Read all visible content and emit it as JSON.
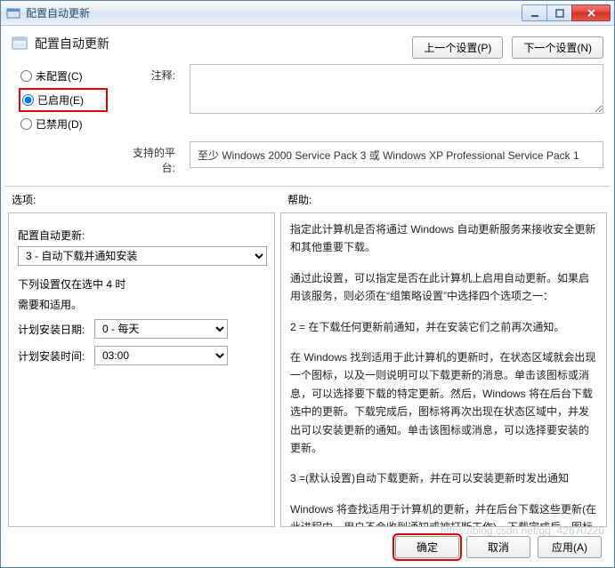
{
  "window": {
    "title": "配置自动更新"
  },
  "header": {
    "page_title": "配置自动更新",
    "prev_btn": "上一个设置(P)",
    "next_btn": "下一个设置(N)"
  },
  "radios": {
    "not_configured": "未配置(C)",
    "enabled": "已启用(E)",
    "disabled": "已禁用(D)",
    "selected": "enabled"
  },
  "labels": {
    "comment": "注释:",
    "platform": "支持的平台:",
    "options": "选项:",
    "help": "帮助:"
  },
  "platform_text": "至少 Windows 2000 Service Pack 3 或 Windows XP Professional Service Pack 1",
  "options_panel": {
    "config_label": "配置自动更新:",
    "config_selected": "3 - 自动下载并通知安装",
    "note_line1": "下列设置仅在选中 4 时",
    "note_line2": "需要和适用。",
    "day_label": "计划安装日期:",
    "day_selected": "0 - 每天",
    "time_label": "计划安装时间:",
    "time_selected": "03:00"
  },
  "help_panel": {
    "p1": "指定此计算机是否将通过 Windows 自动更新服务来接收安全更新和其他重要下载。",
    "p2": "通过此设置，可以指定是否在此计算机上启用自动更新。如果启用该服务，则必须在“组策略设置”中选择四个选项之一：",
    "p3": "2 = 在下载任何更新前通知，并在安装它们之前再次通知。",
    "p4": "在 Windows 找到适用于此计算机的更新时，在状态区域就会出现一个图标，以及一则说明可以下载更新的消息。单击该图标或消息，可以选择要下载的特定更新。然后，Windows 将在后台下载选中的更新。下载完成后，图标将再次出现在状态区域中，并发出可以安装更新的通知。单击该图标或消息，可以选择要安装的更新。",
    "p5": "3 =(默认设置)自动下载更新，并在可以安装更新时发出通知",
    "p6": "Windows 将查找适用于计算机的更新，并在后台下载这些更新(在此进程中，用户不会收到通知或被打断工作)。下载完成后，图标将出现在状态区域中，并发出可以安装更新的通知。单击该图标或"
  },
  "footer": {
    "ok": "确定",
    "cancel": "取消",
    "apply": "应用(A)"
  },
  "watermark": "https://blog.csdn.net/qq_42670220"
}
